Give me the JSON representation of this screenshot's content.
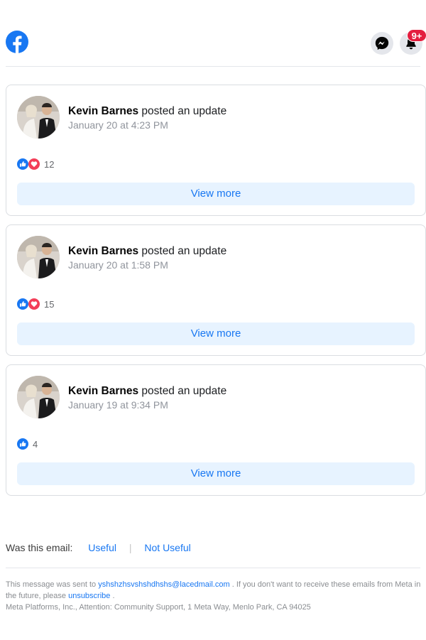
{
  "header": {
    "logo_icon": "facebook-logo-icon",
    "messenger_icon": "messenger-icon",
    "notifications_icon": "bell-icon",
    "notification_badge": "9+"
  },
  "posts": [
    {
      "author": "Kevin Barnes",
      "action": "posted an update",
      "timestamp": "January 20 at 4:23 PM",
      "reactions": [
        "like",
        "love"
      ],
      "reaction_count": "12",
      "view_more": "View more"
    },
    {
      "author": "Kevin Barnes",
      "action": "posted an update",
      "timestamp": "January 20 at 1:58 PM",
      "reactions": [
        "like",
        "love"
      ],
      "reaction_count": "15",
      "view_more": "View more"
    },
    {
      "author": "Kevin Barnes",
      "action": "posted an update",
      "timestamp": "January 19 at 9:34 PM",
      "reactions": [
        "like"
      ],
      "reaction_count": "4",
      "view_more": "View more"
    }
  ],
  "feedback": {
    "label": "Was this email:",
    "useful": "Useful",
    "separator": "|",
    "not_useful": "Not Useful"
  },
  "footer": {
    "sent_prefix": "This message was sent to",
    "email": "yshshzhsvshshdhshs@lacedmail.com",
    "sent_suffix": ". If you don't want to receive these emails from Meta in the future, please",
    "unsubscribe": "unsubscribe",
    "period": ".",
    "address": "Meta Platforms, Inc., Attention: Community Support, 1 Meta Way, Menlo Park, CA 94025"
  },
  "colors": {
    "brand": "#1877f2",
    "badge": "#e41e3f",
    "like": "#1877f2",
    "love": "#f33e58"
  }
}
